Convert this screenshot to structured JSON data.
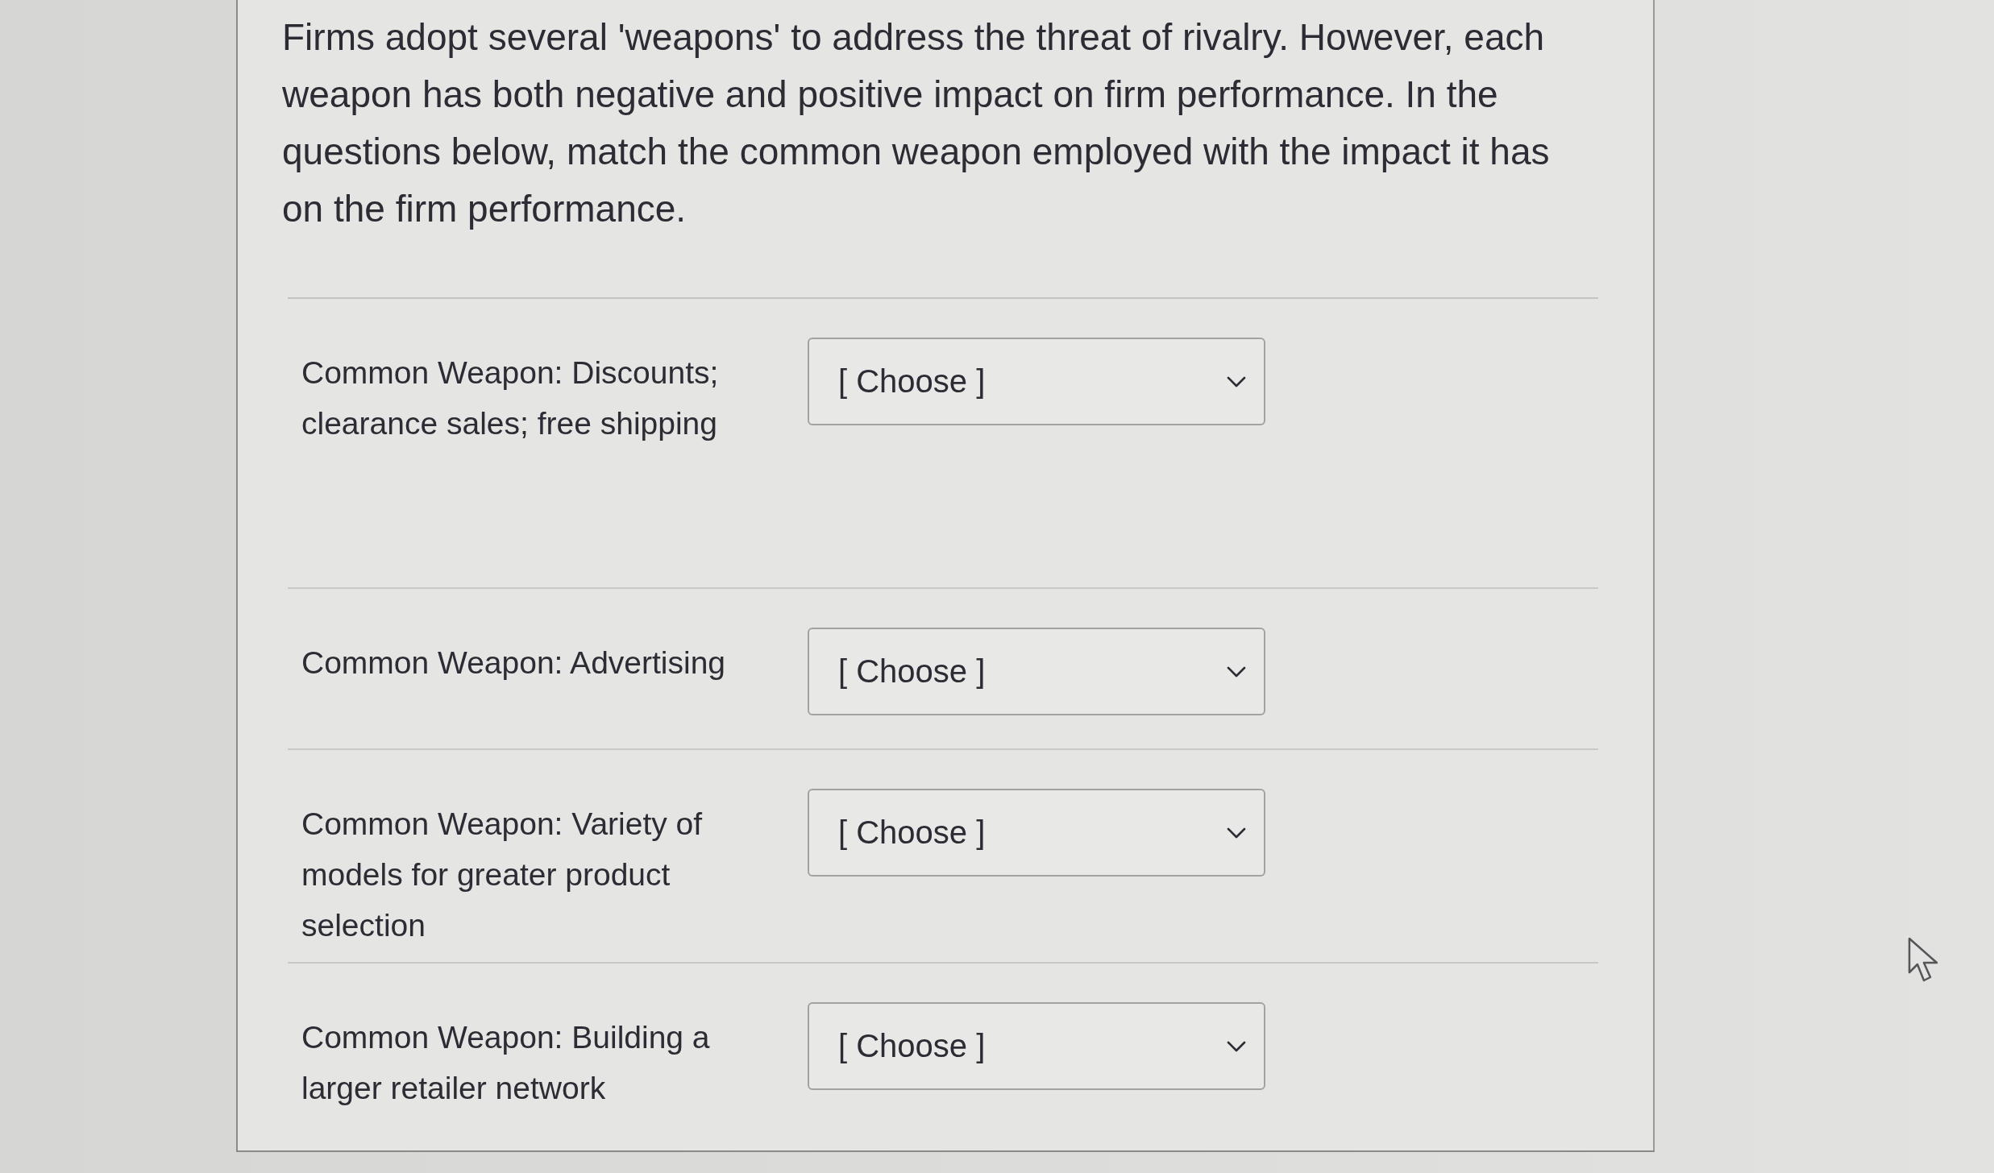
{
  "instructions": "Firms adopt several 'weapons' to address the threat of rivalry. However, each weapon has both negative and positive impact on firm performance. In the questions below, match the common weapon employed with the impact it has on the firm performance.",
  "questions": [
    {
      "label": "Common Weapon: Discounts; clearance sales; free shipping",
      "dropdown": {
        "value": "[ Choose ]"
      }
    },
    {
      "label": "Common Weapon: Advertising",
      "dropdown": {
        "value": "[ Choose ]"
      }
    },
    {
      "label": "Common Weapon: Variety of models for greater product selection",
      "dropdown": {
        "value": "[ Choose ]"
      }
    },
    {
      "label": "Common Weapon: Building a larger retailer network",
      "dropdown": {
        "value": "[ Choose ]"
      }
    }
  ]
}
